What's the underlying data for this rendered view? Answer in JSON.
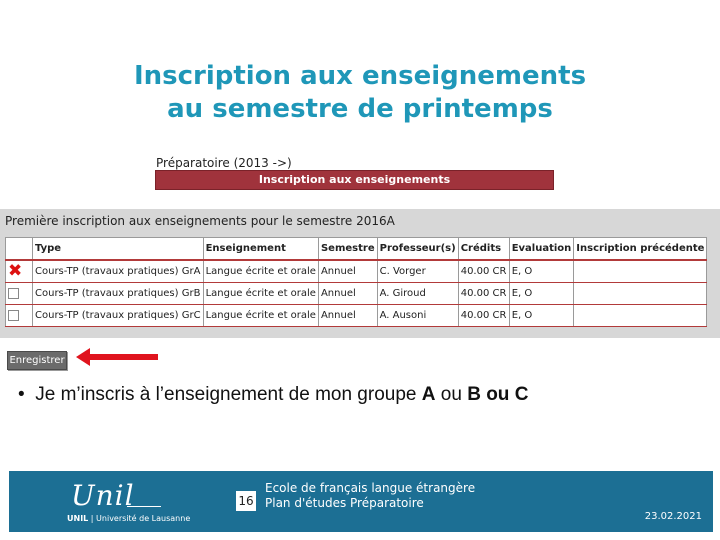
{
  "slide": {
    "title_line1": "Inscription aux enseignements",
    "title_line2": "au semestre de printemps"
  },
  "program": {
    "label": "Préparatoire (2013 ->)",
    "action_bar": "Inscription aux enseignements"
  },
  "panel": {
    "title": "Première inscription aux enseignements pour le semestre 2016A",
    "columns": [
      "",
      "Type",
      "Enseignement",
      "Semestre",
      "Professeur(s)",
      "Crédits",
      "Evaluation",
      "Inscription précédente"
    ],
    "rows": [
      {
        "checked": true,
        "type": "Cours-TP (travaux pratiques) GrA",
        "enseignement": "Langue écrite et orale",
        "semestre": "Annuel",
        "professeur": "C. Vorger",
        "credits": "40.00 CR",
        "evaluation": "E, O",
        "precedente": ""
      },
      {
        "checked": false,
        "type": "Cours-TP (travaux pratiques) GrB",
        "enseignement": "Langue écrite et orale",
        "semestre": "Annuel",
        "professeur": "A. Giroud",
        "credits": "40.00 CR",
        "evaluation": "E, O",
        "precedente": ""
      },
      {
        "checked": false,
        "type": "Cours-TP (travaux pratiques) GrC",
        "enseignement": "Langue écrite et orale",
        "semestre": "Annuel",
        "professeur": "A. Ausoni",
        "credits": "40.00 CR",
        "evaluation": "E, O",
        "precedente": ""
      }
    ],
    "save_label": "Enregistrer"
  },
  "bullet": {
    "text": "Je m’inscris à l’enseignement de mon groupe ",
    "a": "A",
    "ou1": " ou ",
    "b": "B",
    "ou2": " ou ",
    "c": "C"
  },
  "footer": {
    "logo": "Unil",
    "logo_sub_bold": "UNIL",
    "logo_sub": " | Université de Lausanne",
    "page": "16",
    "school_line1": "Ecole de français langue étrangère",
    "school_line2": "Plan d'études Préparatoire",
    "date": "23.02.2021"
  },
  "colors": {
    "title": "#1f97b8",
    "action_bar": "#a0333c",
    "footer": "#1c6f94",
    "arrow": "#e0141e"
  }
}
